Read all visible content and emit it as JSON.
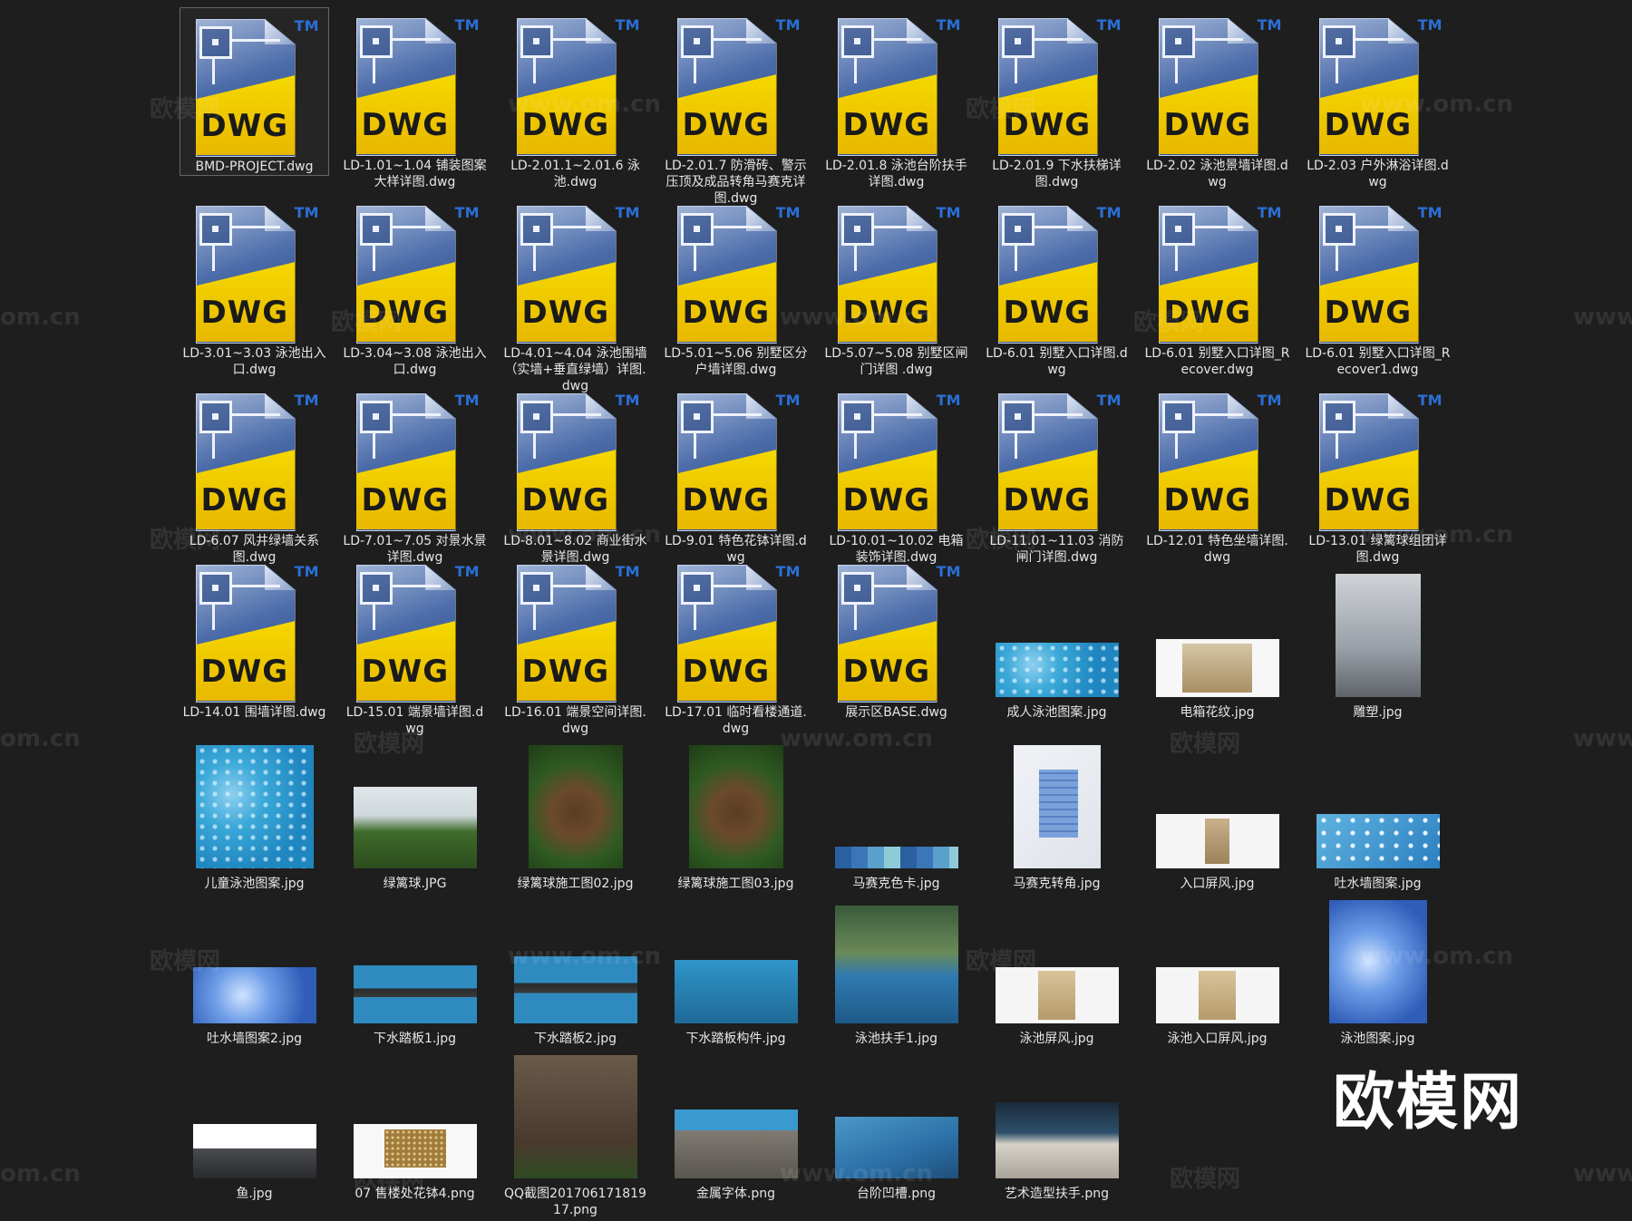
{
  "items": [
    {
      "label": "BMD-PROJECT.dwg",
      "kind": "dwg",
      "icon": "dwg-file-icon",
      "selected": true
    },
    {
      "label": "LD-1.01~1.04 铺装图案大样详图.dwg",
      "kind": "dwg",
      "icon": "dwg-file-icon"
    },
    {
      "label": "LD-2.01.1~2.01.6 泳池.dwg",
      "kind": "dwg",
      "icon": "dwg-file-icon"
    },
    {
      "label": "LD-2.01.7 防滑砖、警示压顶及成品转角马赛克详图.dwg",
      "kind": "dwg",
      "icon": "dwg-file-icon"
    },
    {
      "label": "LD-2.01.8 泳池台阶扶手详图.dwg",
      "kind": "dwg",
      "icon": "dwg-file-icon"
    },
    {
      "label": "LD-2.01.9 下水扶梯详图.dwg",
      "kind": "dwg",
      "icon": "dwg-file-icon"
    },
    {
      "label": "LD-2.02 泳池景墙详图.dwg",
      "kind": "dwg",
      "icon": "dwg-file-icon"
    },
    {
      "label": "LD-2.03 户外淋浴详图.dwg",
      "kind": "dwg",
      "icon": "dwg-file-icon"
    },
    {
      "label": "LD-3.01~3.03 泳池出入口.dwg",
      "kind": "dwg",
      "icon": "dwg-file-icon"
    },
    {
      "label": "LD-3.04~3.08 泳池出入口.dwg",
      "kind": "dwg",
      "icon": "dwg-file-icon"
    },
    {
      "label": "LD-4.01~4.04 泳池围墙（实墙+垂直绿墙）详图.dwg",
      "kind": "dwg",
      "icon": "dwg-file-icon"
    },
    {
      "label": "LD-5.01~5.06 别墅区分户墙详图.dwg",
      "kind": "dwg",
      "icon": "dwg-file-icon"
    },
    {
      "label": "LD-5.07~5.08 别墅区闸门详图 .dwg",
      "kind": "dwg",
      "icon": "dwg-file-icon"
    },
    {
      "label": "LD-6.01 别墅入口详图.dwg",
      "kind": "dwg",
      "icon": "dwg-file-icon"
    },
    {
      "label": "LD-6.01 别墅入口详图_Recover.dwg",
      "kind": "dwg",
      "icon": "dwg-file-icon"
    },
    {
      "label": "LD-6.01 别墅入口详图_Recover1.dwg",
      "kind": "dwg",
      "icon": "dwg-file-icon"
    },
    {
      "label": "LD-6.07 风井绿墙关系图.dwg",
      "kind": "dwg",
      "icon": "dwg-file-icon"
    },
    {
      "label": "LD-7.01~7.05 对景水景详图.dwg",
      "kind": "dwg",
      "icon": "dwg-file-icon"
    },
    {
      "label": "LD-8.01~8.02 商业街水景详图.dwg",
      "kind": "dwg",
      "icon": "dwg-file-icon"
    },
    {
      "label": "LD-9.01 特色花钵详图.dwg",
      "kind": "dwg",
      "icon": "dwg-file-icon"
    },
    {
      "label": "LD-10.01~10.02 电箱装饰详图.dwg",
      "kind": "dwg",
      "icon": "dwg-file-icon"
    },
    {
      "label": "LD-11.01~11.03 消防闸门详图.dwg",
      "kind": "dwg",
      "icon": "dwg-file-icon"
    },
    {
      "label": "LD-12.01 特色坐墙详图.dwg",
      "kind": "dwg",
      "icon": "dwg-file-icon"
    },
    {
      "label": "LD-13.01 绿篱球组团详图.dwg",
      "kind": "dwg",
      "icon": "dwg-file-icon"
    },
    {
      "label": "LD-14.01 围墙详图.dwg",
      "kind": "dwg",
      "icon": "dwg-file-icon"
    },
    {
      "label": "LD-15.01 端景墙详图.dwg",
      "kind": "dwg",
      "icon": "dwg-file-icon"
    },
    {
      "label": "LD-16.01 端景空间详图.dwg",
      "kind": "dwg",
      "icon": "dwg-file-icon"
    },
    {
      "label": "LD-17.01 临时看楼通道.dwg",
      "kind": "dwg",
      "icon": "dwg-file-icon"
    },
    {
      "label": "展示区BASE.dwg",
      "kind": "dwg",
      "icon": "dwg-file-icon"
    },
    {
      "label": "成人泳池图案.jpg",
      "kind": "img",
      "icon": "pool-pattern-thumbnail",
      "style": "th-pool"
    },
    {
      "label": "电箱花纹.jpg",
      "kind": "img",
      "icon": "panel-pattern-thumbnail",
      "style": "th-screen"
    },
    {
      "label": "雕塑.jpg",
      "kind": "img",
      "icon": "sculpture-photo-thumbnail",
      "style": "th-sculpt"
    },
    {
      "label": "儿童泳池图案.jpg",
      "kind": "img",
      "icon": "kids-pool-plan-thumbnail",
      "style": "th-pool"
    },
    {
      "label": "绿篱球.JPG",
      "kind": "img",
      "icon": "hedge-photo-thumbnail",
      "style": "th-garden"
    },
    {
      "label": "绿篱球施工图02.jpg",
      "kind": "img",
      "icon": "construction-photo-thumbnail",
      "style": "th-soil"
    },
    {
      "label": "绿篱球施工图03.jpg",
      "kind": "img",
      "icon": "construction-photo-thumbnail",
      "style": "th-soil"
    },
    {
      "label": "马赛克色卡.jpg",
      "kind": "img",
      "icon": "color-card-thumbnail",
      "style": "th-tile"
    },
    {
      "label": "马赛克转角.jpg",
      "kind": "img",
      "icon": "mosaic-corner-thumbnail",
      "style": "th-mosaic"
    },
    {
      "label": "入口屏风.jpg",
      "kind": "img",
      "icon": "screen-thumbnail",
      "style": "th-panel"
    },
    {
      "label": "吐水墙图案.jpg",
      "kind": "img",
      "icon": "wall-pattern-thumbnail",
      "style": "th-poolwall"
    },
    {
      "label": "吐水墙图案2.jpg",
      "kind": "img",
      "icon": "flower-pattern-thumbnail",
      "style": "th-flower"
    },
    {
      "label": "下水踏板1.jpg",
      "kind": "img",
      "icon": "step-board-thumbnail",
      "style": "th-stepboard"
    },
    {
      "label": "下水踏板2.jpg",
      "kind": "img",
      "icon": "step-board-thumbnail",
      "style": "th-stepboard"
    },
    {
      "label": "下水踏板构件.jpg",
      "kind": "img",
      "icon": "board-part-thumbnail",
      "style": "th-boardpart"
    },
    {
      "label": "泳池扶手1.jpg",
      "kind": "img",
      "icon": "handrail-photo-thumbnail",
      "style": "th-rail"
    },
    {
      "label": "泳池屏风.jpg",
      "kind": "img",
      "icon": "screen-thumbnail",
      "style": "th-scr"
    },
    {
      "label": "泳池入口屏风.jpg",
      "kind": "img",
      "icon": "screen-thumbnail",
      "style": "th-scr"
    },
    {
      "label": "泳池图案.jpg",
      "kind": "img",
      "icon": "pool-pattern-thumbnail",
      "style": "th-flower"
    },
    {
      "label": "鱼.jpg",
      "kind": "img",
      "icon": "fish-sculpture-thumbnail",
      "style": "th-fish"
    },
    {
      "label": "07 售楼处花钵4.png",
      "kind": "img",
      "icon": "planter-thumbnail",
      "style": "th-planter"
    },
    {
      "label": "QQ截图20170617181917.png",
      "kind": "img",
      "icon": "screenshot-thumbnail",
      "style": "th-qq"
    },
    {
      "label": "金属字体.png",
      "kind": "img",
      "icon": "metal-font-thumbnail",
      "style": "th-stone"
    },
    {
      "label": "台阶凹槽.png",
      "kind": "img",
      "icon": "stair-groove-thumbnail",
      "style": "th-stair"
    },
    {
      "label": "艺术造型扶手.png",
      "kind": "img",
      "icon": "art-rail-thumbnail",
      "style": "th-court"
    }
  ],
  "dwg_icon": {
    "text": "DWG",
    "tm": "TM"
  },
  "watermarks": [
    "欧模网",
    "www.om.cn",
    "om.cn"
  ],
  "logo": "欧模网",
  "colors": {
    "background": "#1e1e1e",
    "label": "#e6e6e6",
    "dwg_yellow": "#f0c800",
    "dwg_blue": "#3a5e9e",
    "tm_blue": "#2b6fd6"
  }
}
